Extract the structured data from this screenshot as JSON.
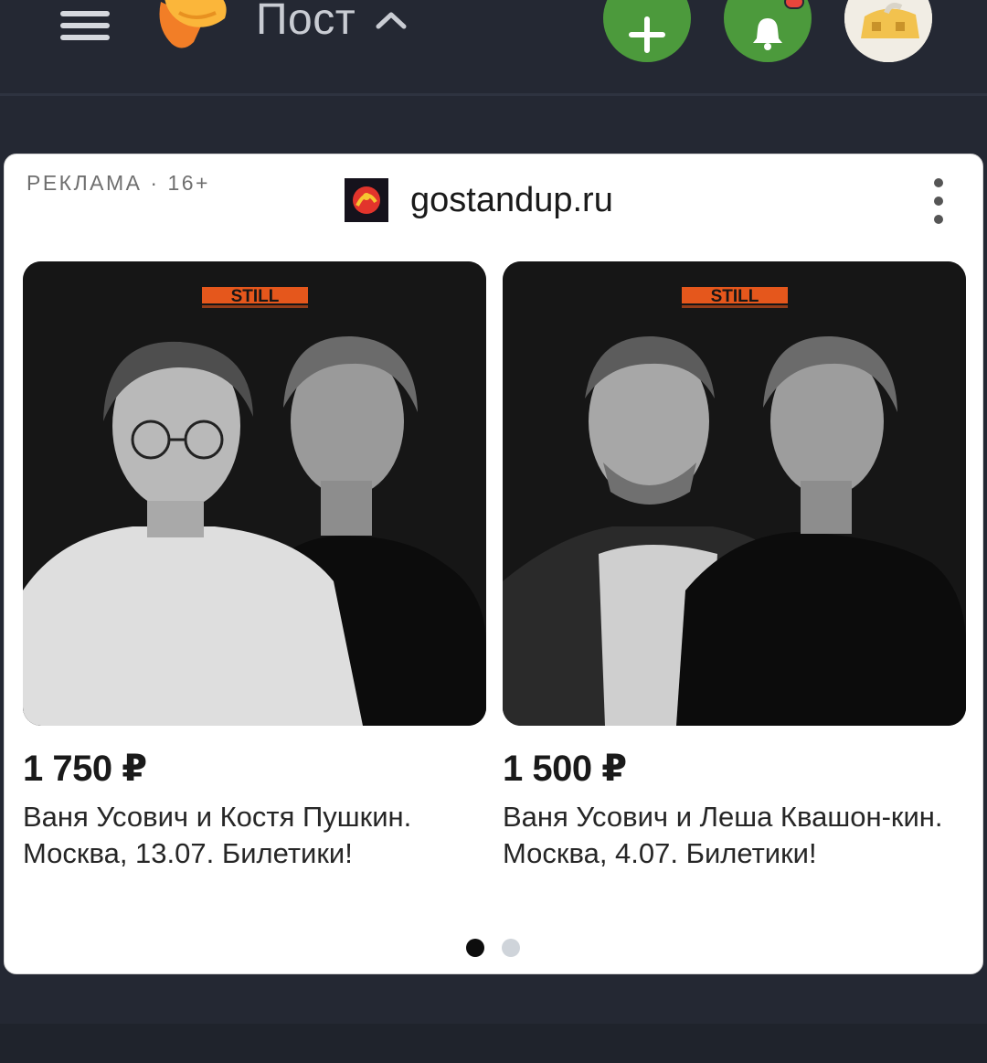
{
  "header": {
    "title": "Пост",
    "add_icon": "plus-icon",
    "bell_icon": "bell-icon",
    "menu_icon": "hamburger-icon",
    "accent_color": "#4c9a3c"
  },
  "ad": {
    "label": "РЕКЛАМА · 16+",
    "site_name": "gostandup.ru",
    "brand_text": "STILL",
    "products": [
      {
        "price": "1 750 ₽",
        "description": "Ваня Усович и Костя Пушкин. Москва, 13.07. Билетики!"
      },
      {
        "price": "1 500 ₽",
        "description": "Ваня Усович и Леша Квашон-кин. Москва, 4.07. Билетики!"
      }
    ],
    "pager": {
      "total": 2,
      "active": 1
    }
  }
}
